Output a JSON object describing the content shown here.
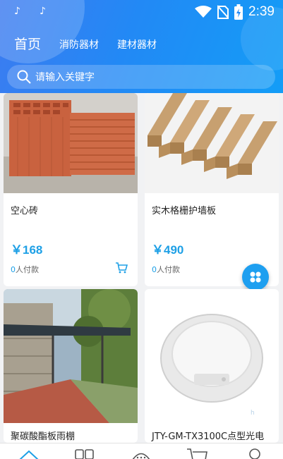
{
  "status_bar": {
    "time": "2:39"
  },
  "header": {
    "tabs": [
      {
        "label": "首页"
      },
      {
        "label": "消防器材"
      },
      {
        "label": "建材器材"
      }
    ],
    "search_placeholder": "请输入关键字"
  },
  "products": [
    {
      "title": "空心砖",
      "price": "￥168",
      "paid_count": "0",
      "paid_label": "人付款"
    },
    {
      "title": "实木格栅护墙板",
      "price": "￥490",
      "paid_count": "0",
      "paid_label": "人付款"
    },
    {
      "title": "聚碳酸酯板雨棚",
      "price": "",
      "paid_count": "",
      "paid_label": ""
    },
    {
      "title": "JTY-GM-TX3100C点型光电",
      "price": "",
      "paid_count": "",
      "paid_label": ""
    }
  ],
  "colors": {
    "accent": "#1ea0e6",
    "header_start": "#3d7bf0",
    "header_end": "#139df7"
  }
}
